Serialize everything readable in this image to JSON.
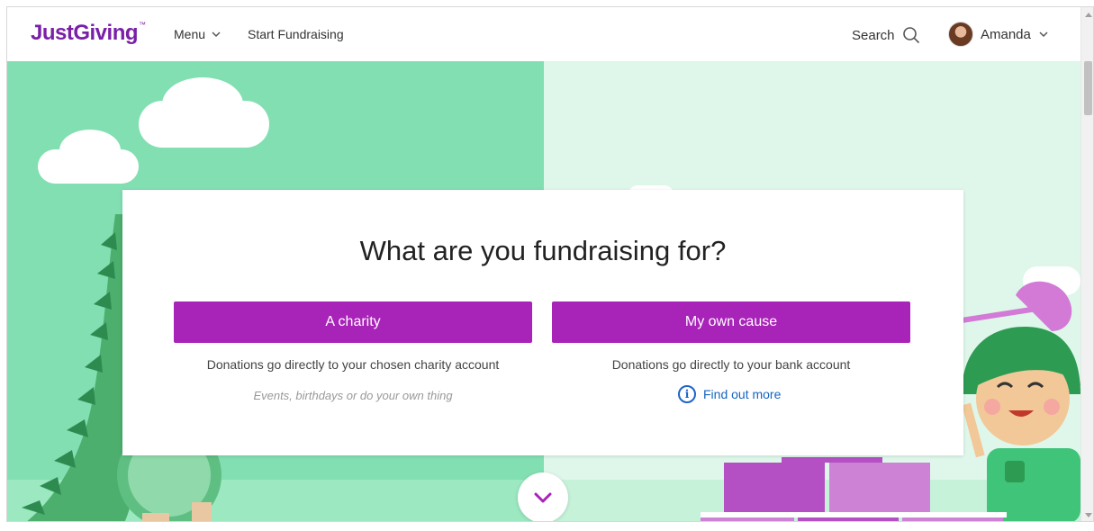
{
  "header": {
    "logo": "JustGiving",
    "logo_mark": "™",
    "menu_label": "Menu",
    "start_fundraising": "Start Fundraising",
    "search_label": "Search",
    "user_name": "Amanda"
  },
  "main": {
    "title": "What are you fundraising for?",
    "options": [
      {
        "button_label": "A charity",
        "description": "Donations go directly to your chosen charity account",
        "note": "Events, birthdays or do your own thing"
      },
      {
        "button_label": "My own cause",
        "description": "Donations go directly to your bank account",
        "link_label": "Find out more"
      }
    ]
  },
  "icons": {
    "menu": "chevron-down-icon",
    "search": "search-icon",
    "user": "chevron-down-icon",
    "info": "info-icon",
    "scroll": "chevron-down-icon"
  },
  "colors": {
    "brand": "#7a1fa8",
    "button": "#a823b8",
    "link": "#1565c0",
    "hero_left": "#82dfb2",
    "hero_right": "#def7ea"
  }
}
